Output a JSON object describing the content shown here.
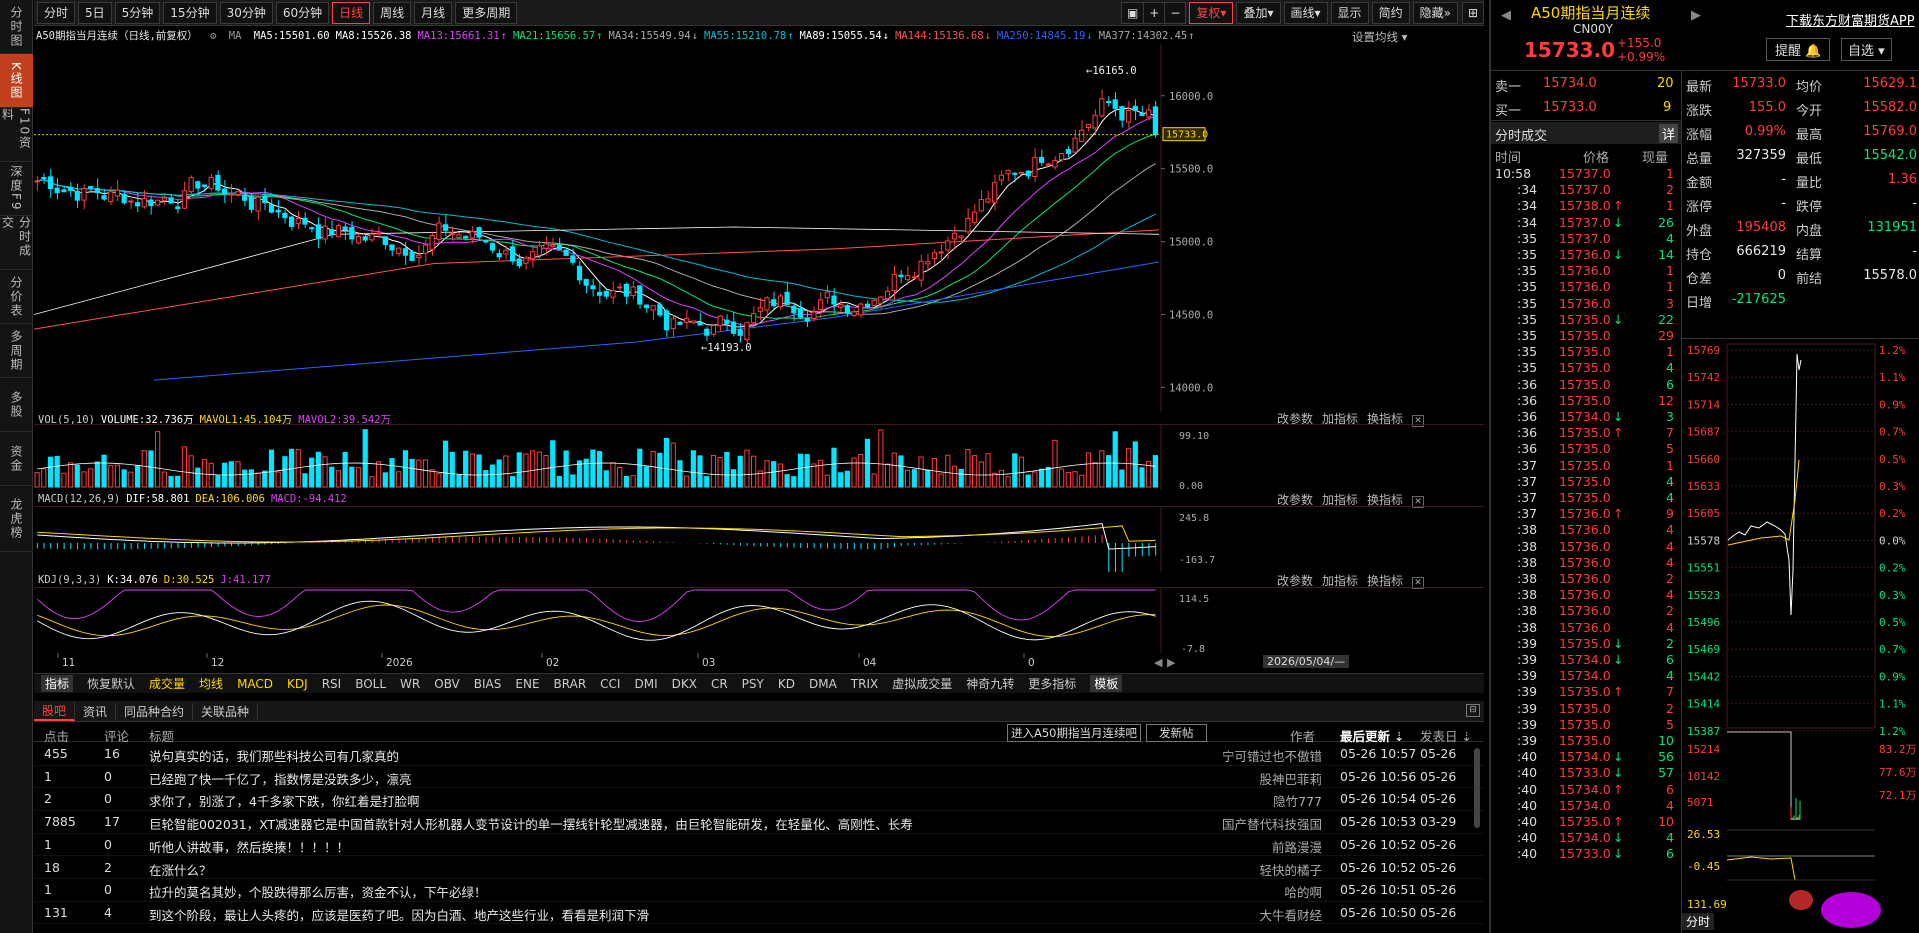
{
  "left_tabs": [
    "分时图",
    "K线图",
    "F10资料",
    "深度F9",
    "分时成交",
    "分价表",
    "多周期",
    "多股",
    "资金",
    "龙虎榜"
  ],
  "toolbar": {
    "periods": [
      "分时",
      "5日",
      "5分钟",
      "15分钟",
      "30分钟",
      "60分钟",
      "日线",
      "周线",
      "月线",
      "更多周期"
    ],
    "right_buttons": [
      "复权",
      "叠加",
      "画线",
      "显示",
      "简约",
      "隐藏"
    ],
    "active_period": "日线"
  },
  "ma_legend": {
    "name": "A50期指当月连续（日线,前复权）",
    "ma_label": "MA",
    "items": [
      {
        "text": "MA5:15501.60",
        "color": "#ffffff"
      },
      {
        "text": "MA8:15526.38",
        "color": "#ffffff"
      },
      {
        "text": "MA13:15661.31",
        "color": "#e040fb"
      },
      {
        "text": "MA21:15656.57",
        "color": "#00e676"
      },
      {
        "text": "MA34:15549.94",
        "color": "#aaaaaa"
      },
      {
        "text": "MA55:15210.78",
        "color": "#00bcd4"
      },
      {
        "text": "MA89:15055.54",
        "color": "#ffffff"
      },
      {
        "text": "MA144:15136.68",
        "color": "#ff5252"
      },
      {
        "text": "MA250:14845.19",
        "color": "#2962ff"
      },
      {
        "text": "MA377:14302.45",
        "color": "#aaaaaa"
      }
    ],
    "settings": "设置均线"
  },
  "kchart": {
    "y_ticks": [
      "16000.0",
      "15500.0",
      "15000.0",
      "14500.0",
      "14000.0"
    ],
    "y_tick_values": [
      16000,
      15500,
      15000,
      14500,
      14000
    ],
    "current_price_tag": "15733.0",
    "high_label": "16165.0",
    "low_label": "14193.0",
    "x_ticks": [
      "11",
      "12",
      "2026",
      "02",
      "03",
      "04",
      "0"
    ],
    "date_tag": "2026/05/04/—"
  },
  "vol": {
    "header": [
      "VOL(5,10)",
      "VOLUME:32.736万",
      "MAVOL1:45.104万",
      "MAVOL2:39.542万"
    ],
    "y_ticks": [
      "99.10",
      "0.00"
    ]
  },
  "macd": {
    "header": [
      "MACD(12,26,9)",
      "DIF:58.801",
      "DEA:106.006",
      "MACD:-94.412"
    ],
    "y_ticks": [
      "245.8",
      "-163.7"
    ]
  },
  "kdj": {
    "header": [
      "KDJ(9,3,3)",
      "K:34.076",
      "D:30.525",
      "J:41.177"
    ],
    "y_ticks": [
      "114.5",
      "-7.8"
    ]
  },
  "panel_controls": [
    "改参数",
    "加指标",
    "换指标"
  ],
  "indicator_bar": [
    "指标",
    "恢复默认",
    "成交量",
    "均线",
    "MACD",
    "KDJ",
    "RSI",
    "BOLL",
    "WR",
    "OBV",
    "BIAS",
    "ENE",
    "BRAR",
    "CCI",
    "DMI",
    "DKX",
    "CR",
    "PSY",
    "KD",
    "DMA",
    "TRIX",
    "虚拟成交量",
    "神奇九转",
    "更多指标",
    "模板"
  ],
  "forum": {
    "tabs": [
      "股吧",
      "资讯",
      "同品种合约",
      "关联品种"
    ],
    "headers": {
      "clicks": "点击",
      "comments": "评论",
      "title": "标题",
      "author": "作者",
      "latest": "最后更新",
      "posted": "发表日"
    },
    "enter_button": "进入A50期指当月连续吧",
    "post_button": "发新帖",
    "rows": [
      {
        "clicks": "455",
        "comments": "16",
        "title": "说句真实的话，我们那些科技公司有几家真的",
        "author": "宁可错过也不傲错",
        "latest": "05-26 10:57",
        "posted": "05-26"
      },
      {
        "clicks": "1",
        "comments": "0",
        "title": "已经跑了快一千亿了，指数愣是没跌多少，凛亮",
        "author": "股神巴菲莉",
        "latest": "05-26 10:56",
        "posted": "05-26"
      },
      {
        "clicks": "2",
        "comments": "0",
        "title": "求你了，别涨了，4千多家下跌，你红着是打脸啊",
        "author": "隐竹777",
        "latest": "05-26 10:54",
        "posted": "05-26"
      },
      {
        "clicks": "7885",
        "comments": "17",
        "title": "巨轮智能002031，XT减速器它是中国首款针对人形机器人变节设计的单一摆线针轮型减速器，由巨轮智能研发，在轻量化、高刚性、长寿",
        "author": "国产替代科技强国",
        "latest": "05-26 10:53",
        "posted": "03-29"
      },
      {
        "clicks": "1",
        "comments": "0",
        "title": "听他人讲故事，然后挨揍！！！！！",
        "author": "前路漫漫",
        "latest": "05-26 10:52",
        "posted": "05-26"
      },
      {
        "clicks": "18",
        "comments": "2",
        "title": "在涨什么？",
        "author": "轻快的橘子",
        "latest": "05-26 10:52",
        "posted": "05-26"
      },
      {
        "clicks": "1",
        "comments": "0",
        "title": "拉升的莫名其妙，个股跌得那么厉害，资金不认，下午必绿！",
        "author": "哈的啊",
        "latest": "05-26 10:51",
        "posted": "05-26"
      },
      {
        "clicks": "131",
        "comments": "4",
        "title": "到这个阶段，最让人头疼的，应该是医药了吧。因为白酒、地产这些行业，看看是利润下滑",
        "author": "大牛看财经",
        "latest": "05-26 10:50",
        "posted": "05-26"
      }
    ]
  },
  "right": {
    "name": "A50期指当月连续",
    "code": "CN00Y",
    "price": "15733.0",
    "change": "+155.0",
    "change_pct": "+0.99%",
    "download": "下载东方财富期货APP",
    "remind_btn": "提醒",
    "watch_btn": "自选",
    "sell1_label": "卖一",
    "sell1_price": "15734.0",
    "sell1_vol": "20",
    "buy1_label": "买一",
    "buy1_price": "15733.0",
    "buy1_vol": "9",
    "quote": [
      {
        "l1": "最新",
        "v1": "15733.0",
        "c1": "red",
        "l2": "均价",
        "v2": "15629.1",
        "c2": "red"
      },
      {
        "l1": "涨跌",
        "v1": "155.0",
        "c1": "red",
        "l2": "今开",
        "v2": "15582.0",
        "c2": "red"
      },
      {
        "l1": "涨幅",
        "v1": "0.99%",
        "c1": "red",
        "l2": "最高",
        "v2": "15769.0",
        "c2": "red"
      },
      {
        "l1": "总量",
        "v1": "327359",
        "c1": "white",
        "l2": "最低",
        "v2": "15542.0",
        "c2": "green"
      },
      {
        "l1": "金额",
        "v1": "-",
        "c1": "white",
        "l2": "量比",
        "v2": "1.36",
        "c2": "red"
      },
      {
        "l1": "涨停",
        "v1": "-",
        "c1": "white",
        "l2": "跌停",
        "v2": "-",
        "c2": "white"
      },
      {
        "l1": "外盘",
        "v1": "195408",
        "c1": "red",
        "l2": "内盘",
        "v2": "131951",
        "c2": "green"
      },
      {
        "l1": "持仓",
        "v1": "666219",
        "c1": "white",
        "l2": "结算",
        "v2": "-",
        "c2": "white"
      },
      {
        "l1": "仓差",
        "v1": "0",
        "c1": "white",
        "l2": "前结",
        "v2": "15578.0",
        "c2": "white"
      },
      {
        "l1": "日增",
        "v1": "-217625",
        "c1": "green",
        "l2": "",
        "v2": "",
        "c2": "white"
      }
    ],
    "ticks_title": "分时成交",
    "ticks_btn": "详",
    "ticks_headers": [
      "时间",
      "价格",
      "现量"
    ],
    "ticks": [
      {
        "t": "10:58",
        "p": "15737.0",
        "a": "",
        "v": "1",
        "vc": "red"
      },
      {
        "t": ":34",
        "p": "15737.0",
        "a": "",
        "v": "2",
        "vc": "red"
      },
      {
        "t": ":34",
        "p": "15738.0",
        "a": "↑",
        "v": "1",
        "vc": "red"
      },
      {
        "t": ":34",
        "p": "15737.0",
        "a": "↓",
        "v": "26",
        "vc": "green"
      },
      {
        "t": ":35",
        "p": "15737.0",
        "a": "",
        "v": "4",
        "vc": "green"
      },
      {
        "t": ":35",
        "p": "15736.0",
        "a": "↓",
        "v": "14",
        "vc": "green"
      },
      {
        "t": ":35",
        "p": "15736.0",
        "a": "",
        "v": "1",
        "vc": "red"
      },
      {
        "t": ":35",
        "p": "15736.0",
        "a": "",
        "v": "1",
        "vc": "red"
      },
      {
        "t": ":35",
        "p": "15736.0",
        "a": "",
        "v": "3",
        "vc": "red"
      },
      {
        "t": ":35",
        "p": "15735.0",
        "a": "↓",
        "v": "22",
        "vc": "green"
      },
      {
        "t": ":35",
        "p": "15735.0",
        "a": "",
        "v": "29",
        "vc": "red"
      },
      {
        "t": ":35",
        "p": "15735.0",
        "a": "",
        "v": "1",
        "vc": "red"
      },
      {
        "t": ":35",
        "p": "15735.0",
        "a": "",
        "v": "4",
        "vc": "green"
      },
      {
        "t": ":36",
        "p": "15735.0",
        "a": "",
        "v": "6",
        "vc": "green"
      },
      {
        "t": ":36",
        "p": "15735.0",
        "a": "",
        "v": "12",
        "vc": "red"
      },
      {
        "t": ":36",
        "p": "15734.0",
        "a": "↓",
        "v": "3",
        "vc": "green"
      },
      {
        "t": ":36",
        "p": "15735.0",
        "a": "↑",
        "v": "7",
        "vc": "red"
      },
      {
        "t": ":36",
        "p": "15735.0",
        "a": "",
        "v": "5",
        "vc": "red"
      },
      {
        "t": ":37",
        "p": "15735.0",
        "a": "",
        "v": "1",
        "vc": "red"
      },
      {
        "t": ":37",
        "p": "15735.0",
        "a": "",
        "v": "4",
        "vc": "green"
      },
      {
        "t": ":37",
        "p": "15735.0",
        "a": "",
        "v": "4",
        "vc": "green"
      },
      {
        "t": ":37",
        "p": "15736.0",
        "a": "↑",
        "v": "9",
        "vc": "red"
      },
      {
        "t": ":38",
        "p": "15736.0",
        "a": "",
        "v": "4",
        "vc": "red"
      },
      {
        "t": ":38",
        "p": "15736.0",
        "a": "",
        "v": "4",
        "vc": "red"
      },
      {
        "t": ":38",
        "p": "15736.0",
        "a": "",
        "v": "4",
        "vc": "red"
      },
      {
        "t": ":38",
        "p": "15736.0",
        "a": "",
        "v": "2",
        "vc": "red"
      },
      {
        "t": ":38",
        "p": "15736.0",
        "a": "",
        "v": "4",
        "vc": "red"
      },
      {
        "t": ":38",
        "p": "15736.0",
        "a": "",
        "v": "2",
        "vc": "red"
      },
      {
        "t": ":38",
        "p": "15736.0",
        "a": "",
        "v": "4",
        "vc": "red"
      },
      {
        "t": ":39",
        "p": "15735.0",
        "a": "↓",
        "v": "2",
        "vc": "green"
      },
      {
        "t": ":39",
        "p": "15734.0",
        "a": "↓",
        "v": "6",
        "vc": "green"
      },
      {
        "t": ":39",
        "p": "15734.0",
        "a": "",
        "v": "4",
        "vc": "green"
      },
      {
        "t": ":39",
        "p": "15735.0",
        "a": "↑",
        "v": "7",
        "vc": "red"
      },
      {
        "t": ":39",
        "p": "15735.0",
        "a": "",
        "v": "2",
        "vc": "red"
      },
      {
        "t": ":39",
        "p": "15735.0",
        "a": "",
        "v": "5",
        "vc": "red"
      },
      {
        "t": ":39",
        "p": "15735.0",
        "a": "",
        "v": "10",
        "vc": "green"
      },
      {
        "t": ":40",
        "p": "15734.0",
        "a": "↓",
        "v": "56",
        "vc": "green"
      },
      {
        "t": ":40",
        "p": "15733.0",
        "a": "↓",
        "v": "57",
        "vc": "green"
      },
      {
        "t": ":40",
        "p": "15734.0",
        "a": "↑",
        "v": "6",
        "vc": "red"
      },
      {
        "t": ":40",
        "p": "15734.0",
        "a": "",
        "v": "4",
        "vc": "red"
      },
      {
        "t": ":40",
        "p": "15735.0",
        "a": "↑",
        "v": "10",
        "vc": "red"
      },
      {
        "t": ":40",
        "p": "15734.0",
        "a": "↓",
        "v": "4",
        "vc": "green"
      },
      {
        "t": ":40",
        "p": "15733.0",
        "a": "↓",
        "v": "6",
        "vc": "green"
      }
    ],
    "mini_left_ticks": [
      "15769",
      "15742",
      "15714",
      "15687",
      "15660",
      "15633",
      "15605",
      "15578",
      "15551",
      "15523",
      "15496",
      "15469",
      "15442",
      "15414",
      "15387"
    ],
    "mini_right_ticks": [
      "1.2%",
      "1.1%",
      "0.9%",
      "0.7%",
      "0.5%",
      "0.3%",
      "0.2%",
      "0.0%",
      "0.2%",
      "0.3%",
      "0.5%",
      "0.7%",
      "0.9%",
      "1.1%",
      "1.2%"
    ],
    "mini_sub_left": [
      "15214",
      "10142",
      "5071",
      "26.53",
      "-0.45",
      "131.69"
    ],
    "mini_sub_right": [
      "83.2万",
      "77.6万",
      "72.1万"
    ],
    "mini_tab": "分时"
  }
}
